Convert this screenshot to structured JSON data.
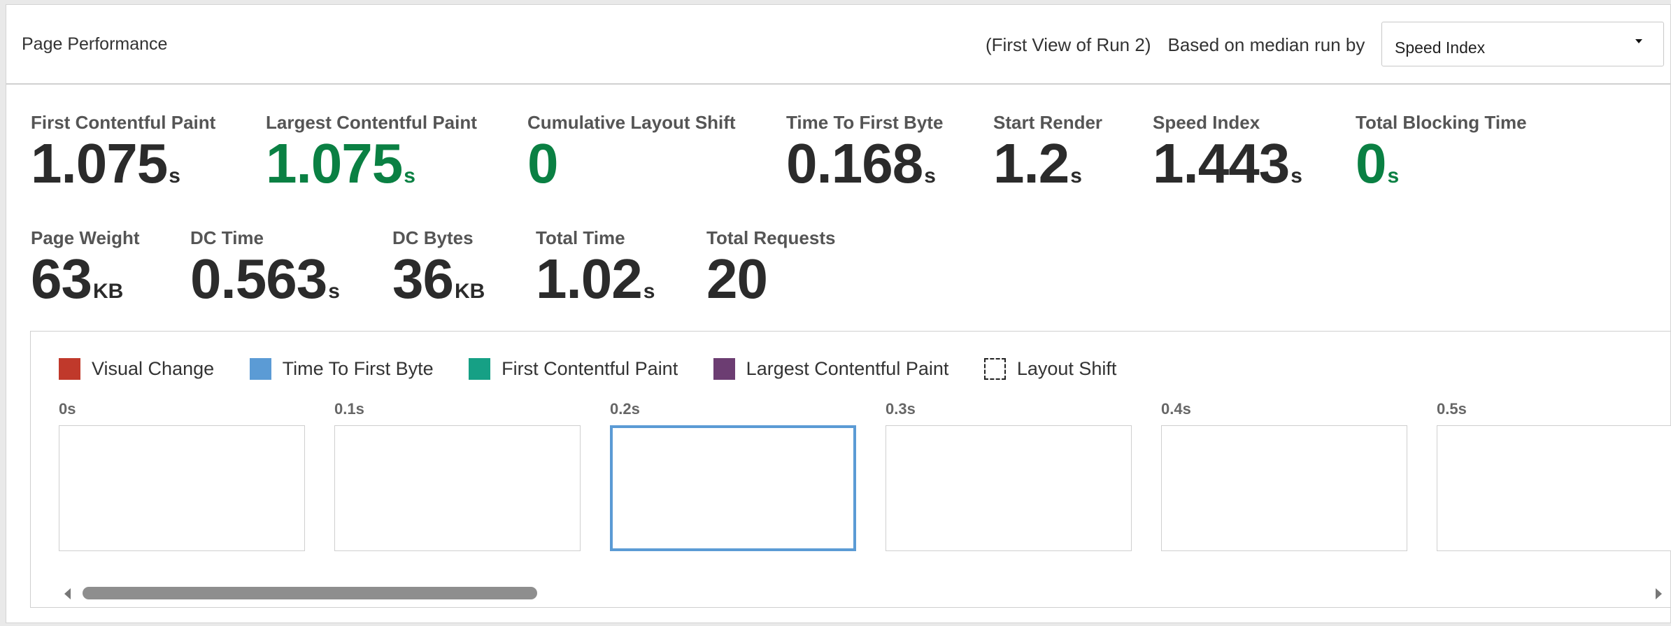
{
  "header": {
    "title": "Page Performance",
    "run_label": "(First View of Run 2)",
    "median_label": "Based on median run by",
    "median_select": {
      "selected": "Speed Index"
    }
  },
  "metrics_row1": [
    {
      "label": "First Contentful Paint",
      "value": "1.075",
      "unit": "s",
      "status": "neutral"
    },
    {
      "label": "Largest Contentful Paint",
      "value": "1.075",
      "unit": "s",
      "status": "good"
    },
    {
      "label": "Cumulative Layout Shift",
      "value": "0",
      "unit": "",
      "status": "good"
    },
    {
      "label": "Time To First Byte",
      "value": "0.168",
      "unit": "s",
      "status": "neutral"
    },
    {
      "label": "Start Render",
      "value": "1.2",
      "unit": "s",
      "status": "neutral"
    },
    {
      "label": "Speed Index",
      "value": "1.443",
      "unit": "s",
      "status": "neutral"
    },
    {
      "label": "Total Blocking Time",
      "value": "0",
      "unit": "s",
      "status": "good"
    }
  ],
  "metrics_row2": [
    {
      "label": "Page Weight",
      "value": "63",
      "unit": "KB"
    },
    {
      "label": "DC Time",
      "value": "0.563",
      "unit": "s"
    },
    {
      "label": "DC Bytes",
      "value": "36",
      "unit": "KB"
    },
    {
      "label": "Total Time",
      "value": "1.02",
      "unit": "s"
    },
    {
      "label": "Total Requests",
      "value": "20",
      "unit": ""
    }
  ],
  "filmstrip": {
    "legend": [
      {
        "label": "Visual Change",
        "color": "#c0392b"
      },
      {
        "label": "Time To First Byte",
        "color": "#5b9bd5"
      },
      {
        "label": "First Contentful Paint",
        "color": "#16a085"
      },
      {
        "label": "Largest Contentful Paint",
        "color": "#6c3d72"
      },
      {
        "label": "Layout Shift",
        "color": "dashed"
      }
    ],
    "frames": [
      "0s",
      "0.1s",
      "0.2s",
      "0.3s",
      "0.4s",
      "0.5s"
    ],
    "selected_frame": 2
  },
  "colors": {
    "good": "#0a8043",
    "accent": "#5b9bd5"
  }
}
